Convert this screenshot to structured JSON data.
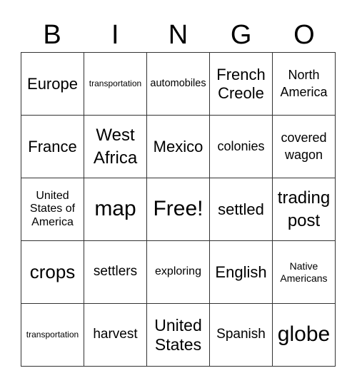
{
  "header": {
    "letters": [
      "B",
      "I",
      "N",
      "G",
      "O"
    ]
  },
  "cells": [
    [
      "Europe",
      "transportation",
      "automobiles",
      "French Creole",
      "North America"
    ],
    [
      "France",
      "West Africa",
      "Mexico",
      "colonies",
      "covered wagon"
    ],
    [
      "United States of America",
      "map",
      "Free!",
      "settled",
      "trading post"
    ],
    [
      "crops",
      "settlers",
      "exploring",
      "English",
      "Native Americans"
    ],
    [
      "transportation",
      "harvest",
      "United States",
      "Spanish",
      "globe"
    ]
  ]
}
